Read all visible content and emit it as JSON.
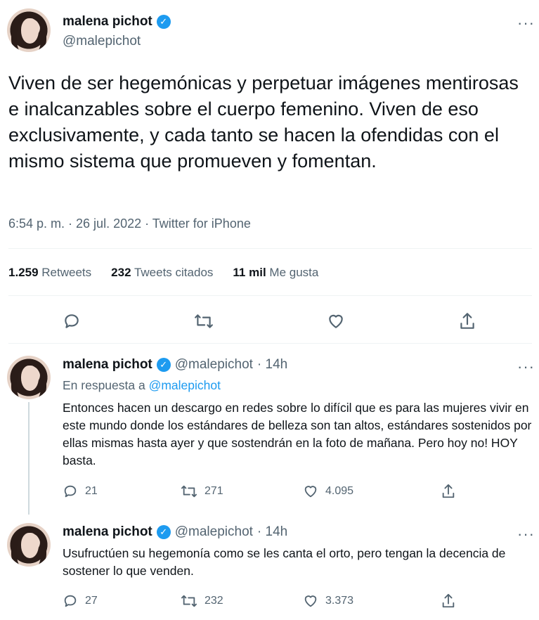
{
  "main_tweet": {
    "author_name": "malena pichot",
    "author_handle": "@malepichot",
    "text": "Viven de ser hegemónicas y perpetuar imágenes mentirosas e inalcanzables sobre el cuerpo femenino. Viven de eso exclusivamente, y cada tanto se hacen la ofendidas con el mismo sistema que promueven y fomentan.",
    "meta": "6:54 p. m. · 26 jul. 2022 · Twitter for iPhone",
    "stats": {
      "retweets_count": "1.259",
      "retweets_label": "Retweets",
      "quotes_count": "232",
      "quotes_label": "Tweets citados",
      "likes_count": "11 mil",
      "likes_label": "Me gusta"
    }
  },
  "replies": [
    {
      "author_name": "malena pichot",
      "author_handle": "@malepichot",
      "time": "· 14h",
      "in_reply_prefix": "En respuesta a",
      "in_reply_handle": "@malepichot",
      "text": "Entonces hacen un descargo en redes sobre lo difícil que es para las mujeres vivir en este mundo donde los estándares de belleza son tan altos, estándares sostenidos por ellas mismas hasta ayer y que sostendrán en la foto de mañana. Pero hoy no! HOY basta.",
      "reply_count": "21",
      "retweet_count": "271",
      "like_count": "4.095"
    },
    {
      "author_name": "malena pichot",
      "author_handle": "@malepichot",
      "time": "· 14h",
      "text": "Usufructúen su hegemonía como se les canta el orto, pero tengan la decencia de sostener lo que venden.",
      "reply_count": "27",
      "retweet_count": "232",
      "like_count": "3.373"
    }
  ],
  "colors": {
    "accent": "#1d9bf0",
    "secondary_text": "#536471",
    "divider": "#eff3f4"
  }
}
